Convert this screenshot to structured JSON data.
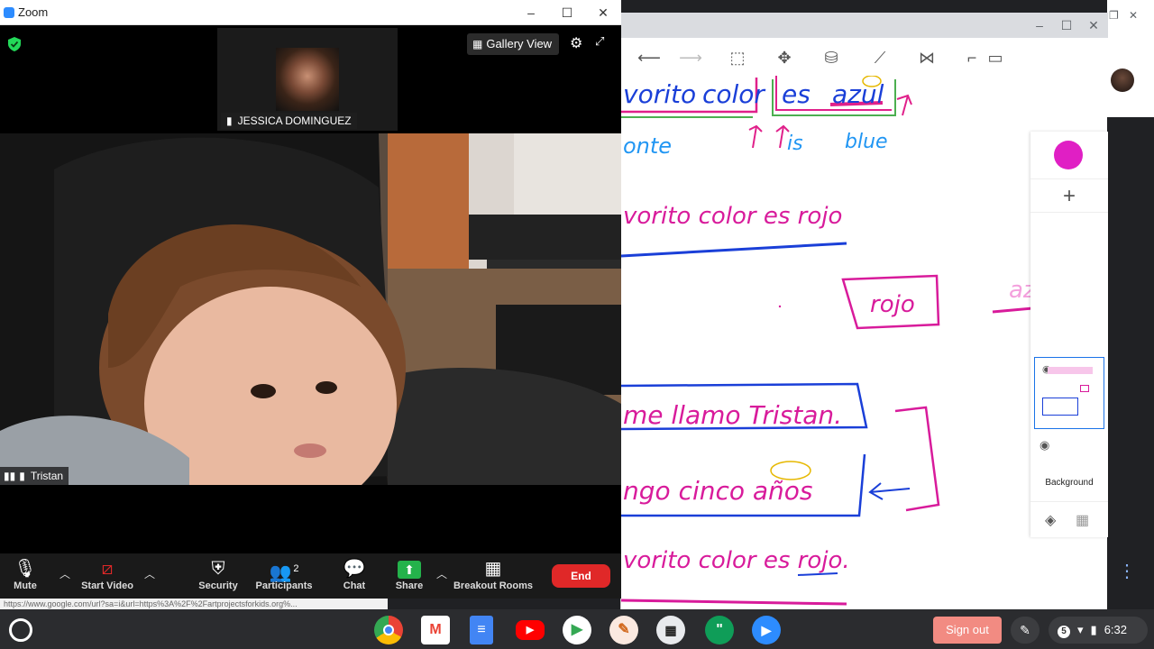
{
  "zoom": {
    "title": "Zoom",
    "view_mode_label": "Gallery View",
    "thumbnail_participant": "JESSICA DOMINGUEZ",
    "main_participant": "Tristan",
    "controls": {
      "mute": "Mute",
      "start_video": "Start Video",
      "security": "Security",
      "participants": "Participants",
      "participants_count": "2",
      "chat": "Chat",
      "share": "Share",
      "breakout_rooms": "Breakout Rooms",
      "end": "End"
    },
    "status_url": "https://www.google.com/url?sa=i&url=https%3A%2F%2Fartprojectsforkids.org%..."
  },
  "canvas": {
    "layer_background_label": "Background",
    "brush_color": "#e01fc4",
    "lines": [
      {
        "text": "vorito color es azul",
        "color": "#d81b9b"
      },
      {
        "text": "onte is blue",
        "color": "#1a73e8"
      },
      {
        "text": "vorito color es rojo",
        "color": "#d81b9b"
      },
      {
        "text": "rojo",
        "color": "#d81b9b"
      },
      {
        "text": "azul",
        "color": "#d81b9b"
      },
      {
        "text": "me llamo Tristan.",
        "color": "#d81b9b"
      },
      {
        "text": "ngo cinco años",
        "color": "#d81b9b"
      },
      {
        "text": "vorito color es rojo.",
        "color": "#d81b9b"
      }
    ]
  },
  "shelf": {
    "signout_label": "Sign out",
    "clock": "6:32",
    "apps": [
      "chrome-icon",
      "gmail-icon",
      "docs-icon",
      "youtube-icon",
      "play-store-icon",
      "pencil-app-icon",
      "calculator-icon",
      "hangouts-icon",
      "zoom-app-icon"
    ]
  }
}
